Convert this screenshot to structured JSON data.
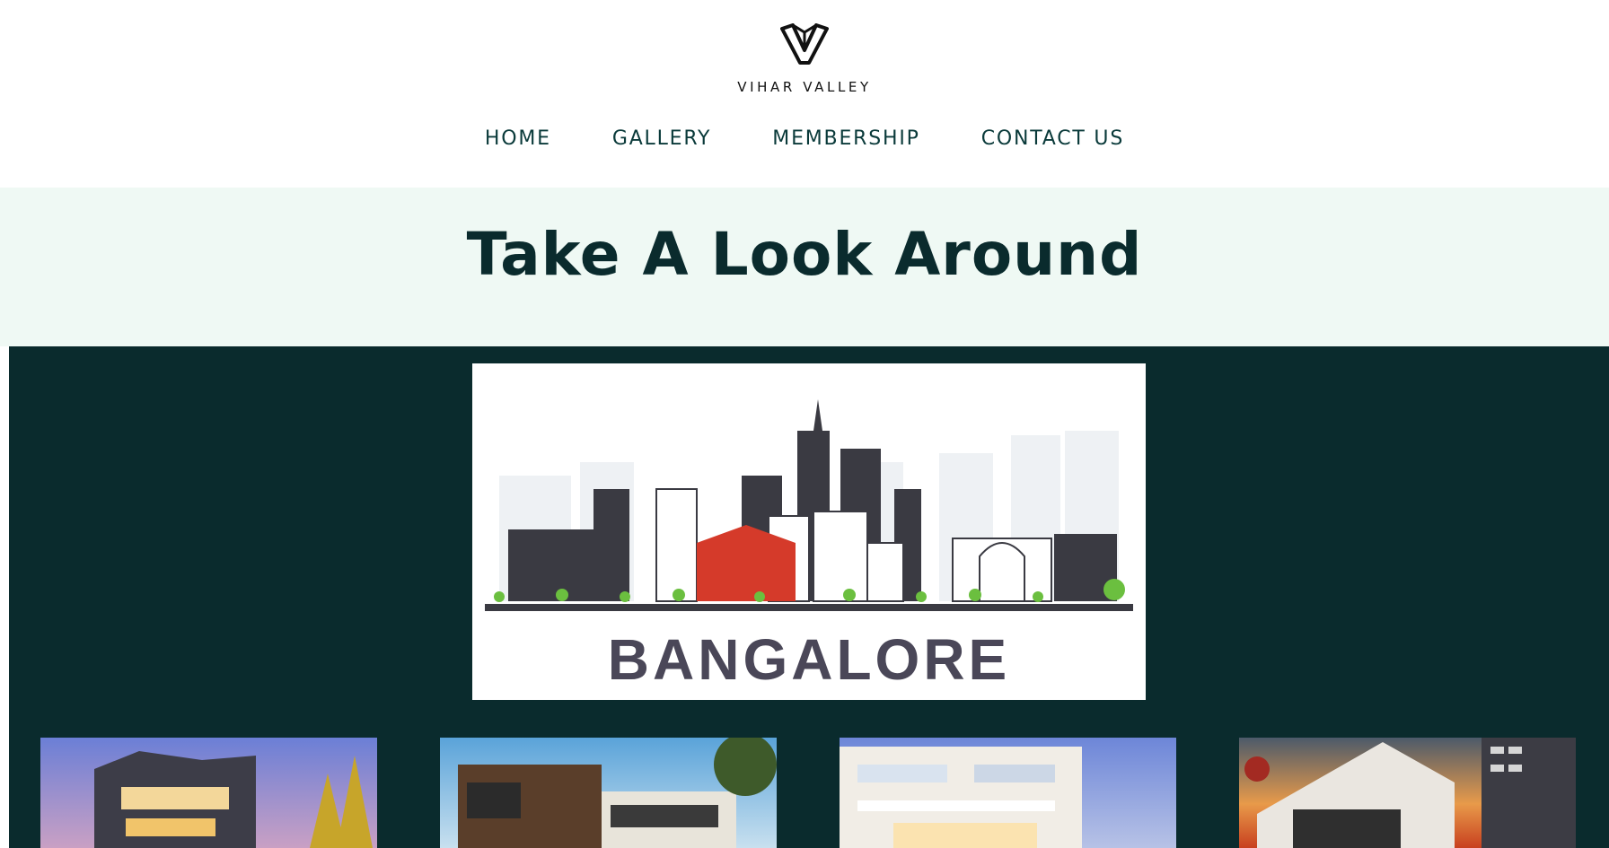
{
  "brand": {
    "name": "VIHAR VALLEY",
    "logo_icon": "v-logo-icon"
  },
  "nav": {
    "items": [
      {
        "label": "HOME"
      },
      {
        "label": "GALLERY"
      },
      {
        "label": "MEMBERSHIP"
      },
      {
        "label": "CONTACT US"
      }
    ]
  },
  "hero": {
    "title": "Take A Look Around"
  },
  "gallery": {
    "feature": {
      "caption": "BANGALORE",
      "alt": "Bangalore skyline illustration"
    },
    "thumbnails": [
      {
        "alt": "Modern villa at dusk"
      },
      {
        "alt": "Contemporary house with wood facade"
      },
      {
        "alt": "White apartment building"
      },
      {
        "alt": "Villa at sunset"
      }
    ]
  },
  "colors": {
    "dark_teal": "#0a2b2d",
    "mint": "#eff9f4",
    "nav_text": "#0a3a3a",
    "accent_red": "#d53a2a"
  }
}
